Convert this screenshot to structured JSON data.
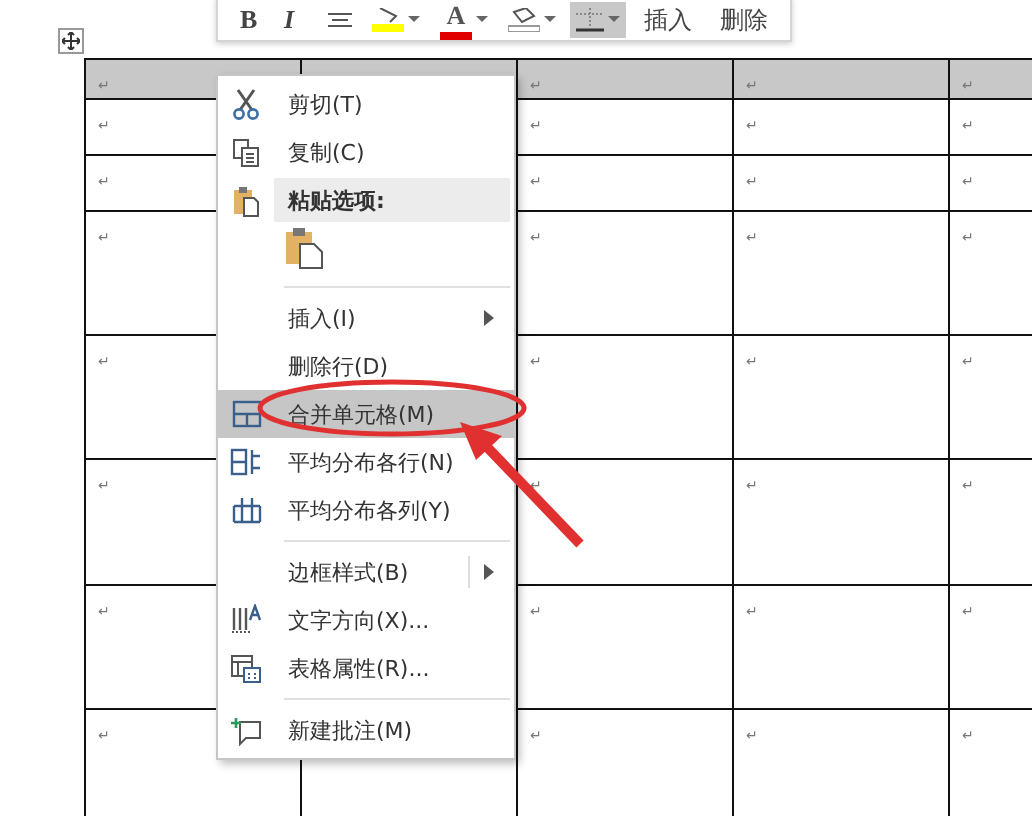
{
  "mini_toolbar": {
    "buttons": [
      {
        "kind": "bold",
        "label": "B",
        "selected": false
      },
      {
        "kind": "italic",
        "label": "I",
        "selected": false
      },
      {
        "kind": "align",
        "selected": false
      },
      {
        "kind": "highlight",
        "color": "#ffff00",
        "selected": false
      },
      {
        "kind": "fontcolor",
        "label": "A",
        "color": "#e00000",
        "selected": false
      },
      {
        "kind": "shading",
        "selected": false
      },
      {
        "kind": "borders",
        "selected": true
      }
    ],
    "actions": [
      "插入",
      "删除"
    ]
  },
  "table": {
    "rows": [
      [
        "↵",
        null,
        "↵",
        "↵",
        "↵"
      ],
      [
        "↵",
        null,
        "↵",
        "↵",
        "↵"
      ],
      [
        "↵",
        null,
        "↵",
        "↵",
        "↵"
      ],
      [
        "↵",
        null,
        "↵",
        "↵",
        "↵"
      ],
      [
        "↵",
        null,
        "↵",
        "↵",
        "↵"
      ],
      [
        "↵",
        null,
        "↵",
        "↵",
        "↵"
      ],
      [
        "↵",
        null,
        "↵",
        "↵",
        "↵"
      ],
      [
        "↵",
        null,
        "↵",
        "↵",
        "↵"
      ]
    ]
  },
  "context_menu": {
    "items": [
      {
        "kind": "item",
        "label": "剪切(T)",
        "selected": false
      },
      {
        "kind": "item",
        "label": "复制(C)",
        "selected": false
      },
      {
        "kind": "header",
        "label": "粘贴选项:"
      },
      {
        "kind": "paste_options"
      },
      {
        "kind": "separator"
      },
      {
        "kind": "item",
        "label": "插入(I)",
        "submenu": true,
        "selected": false
      },
      {
        "kind": "item",
        "label": "删除行(D)",
        "selected": false
      },
      {
        "kind": "item",
        "label": "合并单元格(M)",
        "selected": true
      },
      {
        "kind": "item",
        "label": "平均分布各行(N)",
        "selected": false
      },
      {
        "kind": "item",
        "label": "平均分布各列(Y)",
        "selected": false
      },
      {
        "kind": "separator"
      },
      {
        "kind": "item",
        "label": "边框样式(B)",
        "submenu": true,
        "selected": false
      },
      {
        "kind": "item",
        "label": "文字方向(X)...",
        "selected": false
      },
      {
        "kind": "item",
        "label": "表格属性(R)...",
        "selected": false
      },
      {
        "kind": "separator"
      },
      {
        "kind": "item",
        "label": "新建批注(M)",
        "selected": false
      }
    ]
  }
}
